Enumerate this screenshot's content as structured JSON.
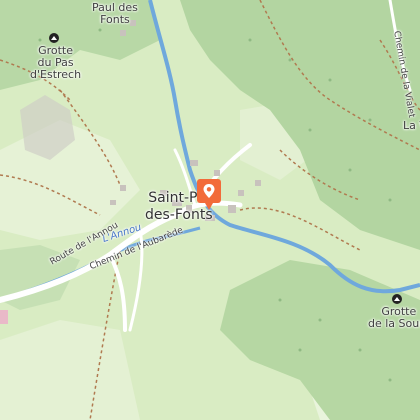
{
  "map": {
    "colors": {
      "meadow": "#d9ecc3",
      "forest": "#b5d6a4",
      "water": "#6fa8dc",
      "road": "#ffffff",
      "track": "#b07a50",
      "marker": "#f26b3a"
    },
    "labels": {
      "town": "Saint-Paul-des-Fonts",
      "town_line1": "Saint-Pa",
      "town_line1b": "l",
      "town_line2": "des-Fonts",
      "village_top_line1": "Paul des",
      "village_top_line2": "Fonts",
      "cave_nw_line1": "Grotte",
      "cave_nw_line2": "du Pas",
      "cave_nw_line3": "d'Estrech",
      "cave_se_line1": "Grotte",
      "cave_se_line2": "de la Sourc",
      "river": "L'Annou",
      "road_annou": "Route de l'Annou",
      "road_aubarede": "Chemin de l'Aubarède",
      "road_vialette": "Chemin de la Vialet",
      "place_east": "La V"
    },
    "icons": {
      "marker": "map-pin-icon",
      "cave": "cave-icon"
    }
  }
}
